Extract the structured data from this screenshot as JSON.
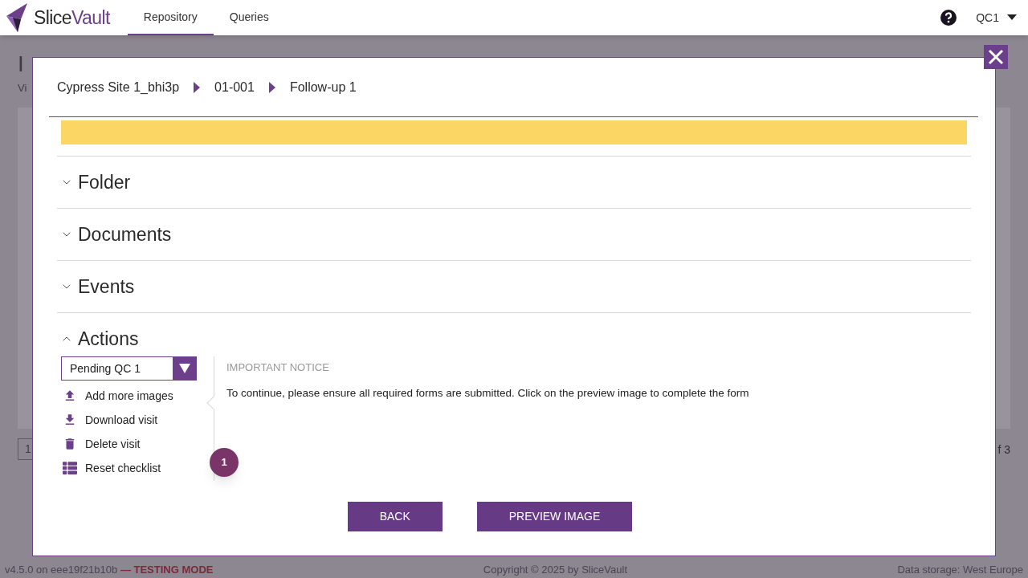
{
  "header": {
    "logo": {
      "first": "Slice",
      "second": "Vault"
    },
    "nav": [
      {
        "label": "Repository",
        "selected": true
      },
      {
        "label": "Queries",
        "selected": false
      }
    ],
    "user": "QC1"
  },
  "background": {
    "heading": "I",
    "subtitle": "Vi",
    "pager_page": "1",
    "pager_total": "f 3"
  },
  "footer": {
    "version": "v4.5.0 on eee19f21b10b",
    "mode": "— TESTING MODE",
    "copyright": "Copyright © 2025 by SliceVault",
    "storage": "Data storage: West Europe"
  },
  "modal": {
    "breadcrumb": [
      "Cypress Site 1_bhi3p",
      "01-001",
      "Follow-up 1"
    ],
    "sections": [
      {
        "title": "Folder",
        "expanded": false
      },
      {
        "title": "Documents",
        "expanded": false
      },
      {
        "title": "Events",
        "expanded": false
      },
      {
        "title": "Actions",
        "expanded": true
      }
    ],
    "status_select": {
      "value": "Pending QC 1"
    },
    "actions": [
      {
        "label": "Add more images",
        "kind": "upload"
      },
      {
        "label": "Download visit",
        "kind": "download"
      },
      {
        "label": "Delete visit",
        "kind": "trash"
      },
      {
        "label": "Reset checklist",
        "kind": "list"
      }
    ],
    "notice": {
      "title": "IMPORTANT NOTICE",
      "text": "To continue, please ensure all required forms are submitted. Click on the preview image to complete the form"
    },
    "step_badge": "1",
    "buttons": [
      "BACK",
      "PREVIEW IMAGE"
    ]
  }
}
